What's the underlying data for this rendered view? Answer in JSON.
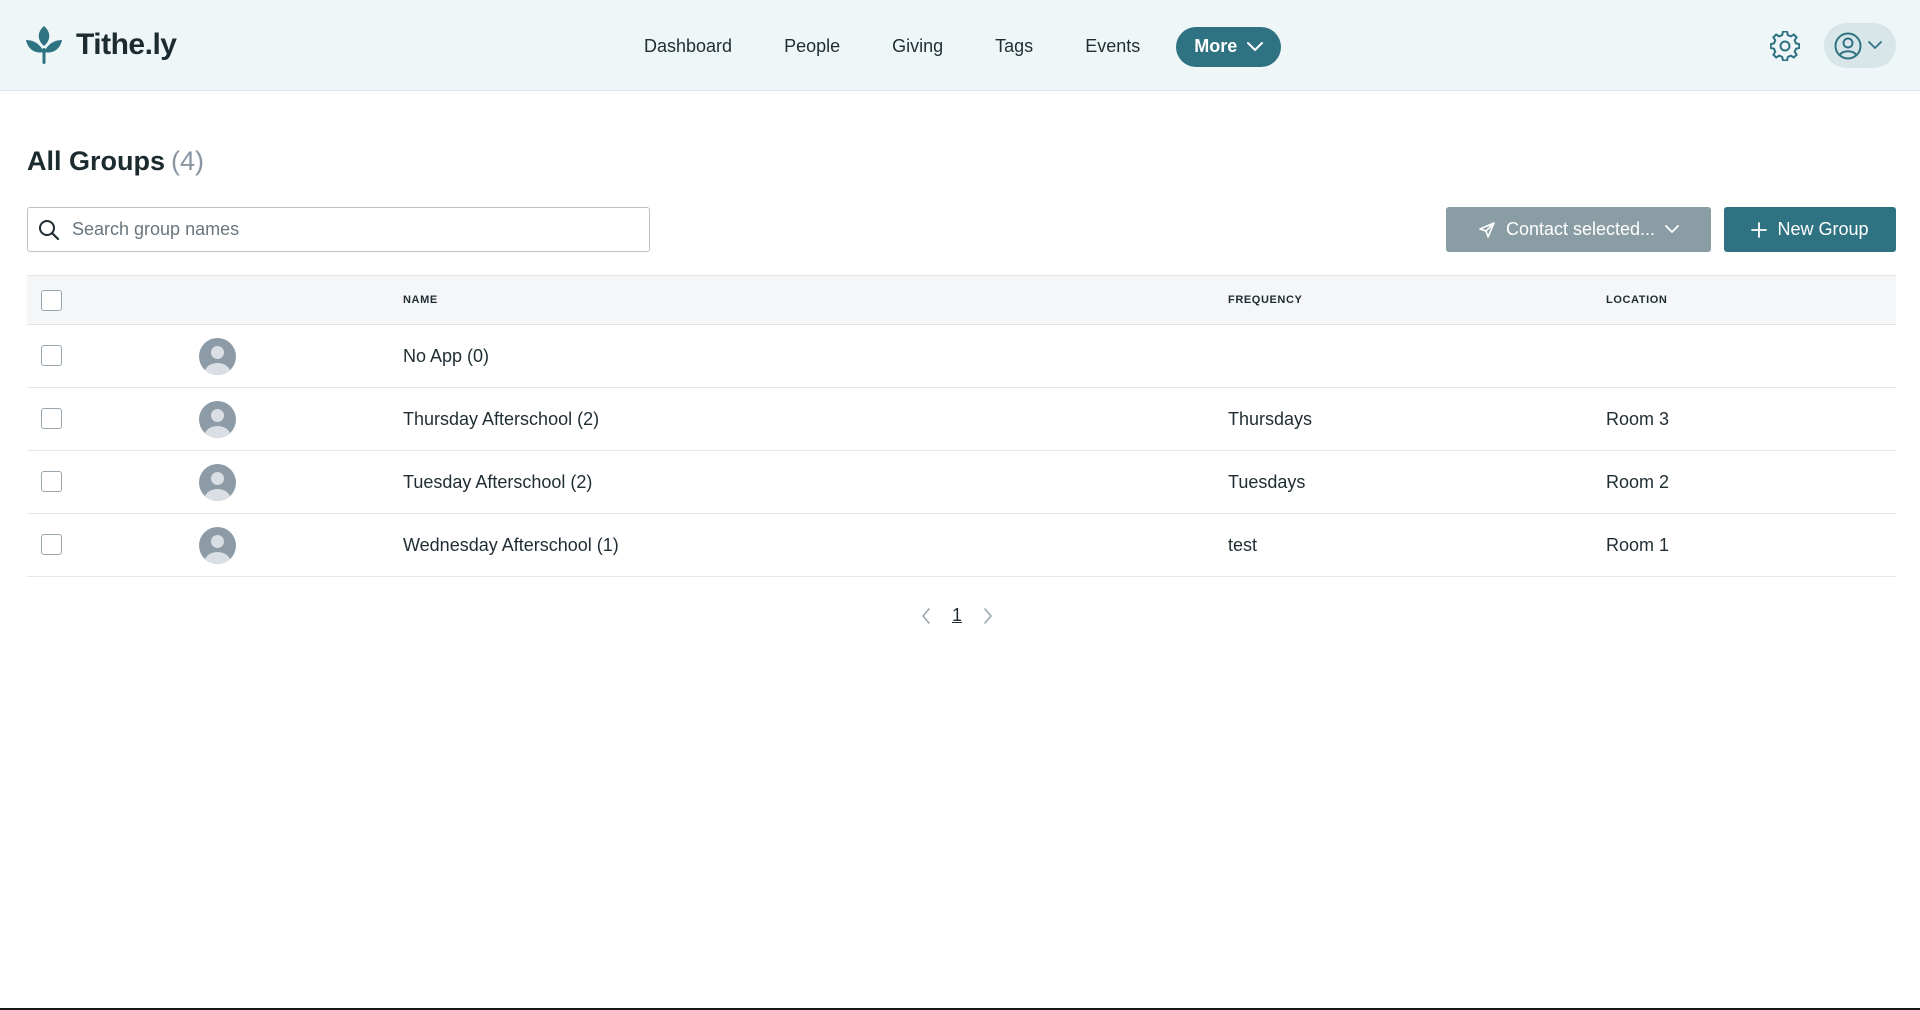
{
  "brand": {
    "name": "Tithe.ly"
  },
  "nav": {
    "items": [
      {
        "label": "Dashboard"
      },
      {
        "label": "People"
      },
      {
        "label": "Giving"
      },
      {
        "label": "Tags"
      },
      {
        "label": "Events"
      }
    ],
    "more_label": "More"
  },
  "header": {
    "title": "All Groups",
    "count": "(4)"
  },
  "search": {
    "placeholder": "Search group names",
    "value": ""
  },
  "actions": {
    "contact_label": "Contact selected...",
    "new_group_label": "New Group"
  },
  "table": {
    "columns": {
      "name": "NAME",
      "frequency": "FREQUENCY",
      "location": "LOCATION"
    },
    "rows": [
      {
        "name": "No App (0)",
        "frequency": "",
        "location": ""
      },
      {
        "name": "Thursday Afterschool (2)",
        "frequency": "Thursdays",
        "location": "Room 3"
      },
      {
        "name": "Tuesday Afterschool (2)",
        "frequency": "Tuesdays",
        "location": "Room 2"
      },
      {
        "name": "Wednesday Afterschool (1)",
        "frequency": "test",
        "location": "Room 1"
      }
    ]
  },
  "pagination": {
    "current_page": "1"
  },
  "colors": {
    "accent": "#2f7282",
    "topbar_bg": "#eef6f8",
    "disabled_button": "#8b9da4"
  },
  "icons": {
    "logo": "sprout-logo-icon",
    "more": "chevron-down-icon",
    "settings": "gear-icon",
    "account": "user-circle-icon",
    "search": "search-icon",
    "contact": "send-icon",
    "new_group": "plus-icon",
    "avatar": "user-avatar-icon",
    "prev": "chevron-left-icon",
    "next": "chevron-right-icon"
  }
}
